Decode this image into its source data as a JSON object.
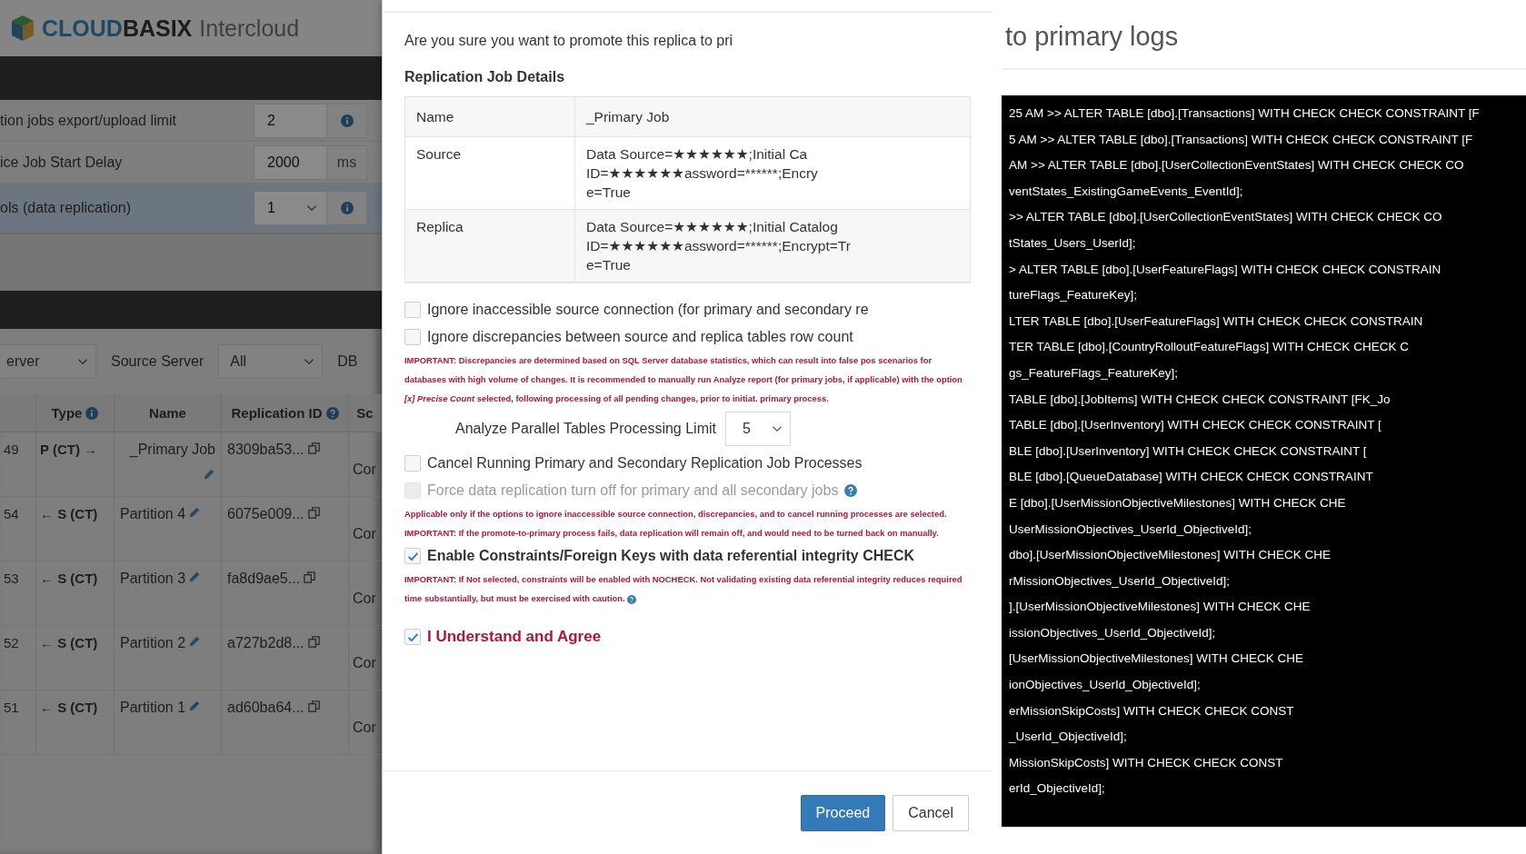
{
  "background_app": {
    "brand": {
      "first": "CLOUD",
      "second": "BASIX",
      "product": "Intercloud"
    },
    "settings": [
      {
        "label": "tion jobs export/upload limit",
        "value": "2",
        "kind": "info",
        "selected": false
      },
      {
        "label": "ice Job Start Delay",
        "value": "2000",
        "kind": "unit",
        "unit": "ms",
        "selected": false
      },
      {
        "label": "ols (data replication)",
        "value": "1",
        "kind": "select-info",
        "selected": true
      }
    ],
    "filters": [
      {
        "kind": "select",
        "text": "erver"
      },
      {
        "kind": "label",
        "text": "Source Server"
      },
      {
        "kind": "select",
        "text": "All"
      },
      {
        "kind": "label",
        "text": "DB"
      }
    ],
    "table": {
      "columns": [
        "Type",
        "Name",
        "Replication ID",
        "Sc"
      ],
      "rows": [
        {
          "id": "49",
          "type": "P (CT) →",
          "name": "_Primary Job",
          "replication_id": "8309ba53...",
          "column_5": "Cor"
        },
        {
          "id": "54",
          "type": "← S (CT)",
          "name": "Partition 4",
          "replication_id": "6075e009...",
          "column_5": "Cor"
        },
        {
          "id": "53",
          "type": "← S (CT)",
          "name": "Partition 3",
          "replication_id": "fa8d9ae5...",
          "column_5": "Cor"
        },
        {
          "id": "52",
          "type": "← S (CT)",
          "name": "Partition 2",
          "replication_id": "a727b2d8...",
          "column_5": "Cor"
        },
        {
          "id": "51",
          "type": "← S (CT)",
          "name": "Partition 1",
          "replication_id": "ad60ba64...",
          "column_5": "Cor"
        }
      ]
    }
  },
  "modal": {
    "question": "Are you sure you want to promote this replica to pri",
    "details_title": "Replication Job Details",
    "details": [
      {
        "label": "Name",
        "value": "_Primary Job"
      },
      {
        "label": "Source",
        "value": "Data Source=★★★★★★;Initial Ca\nID=★★★★★★assword=******;Encry\ne=True"
      },
      {
        "label": "Replica",
        "value": "Data Source=★★★★★★;Initial Catalog\nID=★★★★★★assword=******;Encrypt=Tr\ne=True"
      }
    ],
    "options": [
      {
        "kind": "checkbox",
        "label": "Ignore inaccessible source connection (for primary and secondary re",
        "checked": false
      },
      {
        "kind": "checkbox",
        "label": "Ignore discrepancies between source and replica tables row count",
        "checked": false
      },
      {
        "kind": "note",
        "text": "IMPORTANT: Discrepancies are determined based on SQL Server database statistics, which can result into false pos scenarios for databases with high volume of changes. It is recommended to manually run Analyze report (for primary jobs, if applicable) with the option *[x] Precise Count* selected, following processing of all pending changes, prior to initiat. primary process."
      },
      {
        "kind": "select",
        "label": "Analyze Parallel Tables Processing Limit",
        "value": "5"
      },
      {
        "kind": "checkbox",
        "label": "Cancel Running Primary and Secondary Replication Job Processes",
        "checked": false
      },
      {
        "kind": "checkbox",
        "label": "Force data replication turn off for primary and all secondary jobs",
        "checked": false,
        "disabled": true,
        "help": true
      },
      {
        "kind": "note",
        "text": "Applicable only if the options to ignore inaccessible source connection, discrepancies, and to cancel running processes are selected."
      },
      {
        "kind": "note",
        "text": "IMPORTANT: If the promote-to-primary process fails, data replication will remain off, and would need to be turned back on manually."
      },
      {
        "kind": "emphasis",
        "label": "Enable Constraints/Foreign Keys with data referential integrity CHECK",
        "checked": true
      },
      {
        "kind": "note",
        "text": "IMPORTANT: If Not selected, constraints will be enabled with NOCHECK. Not validating existing data referential integrity reduces required time substantially, but must be exercised with caution.",
        "help": true
      },
      {
        "kind": "consent",
        "label": "I Understand and Agree",
        "checked": true
      }
    ],
    "buttons": [
      {
        "label": "Proceed",
        "kind": "primary"
      },
      {
        "label": "Cancel",
        "kind": "default"
      }
    ]
  },
  "log_panel": {
    "title": "to primary logs",
    "lines": [
      "25 AM >> ALTER TABLE [dbo].[Transactions] WITH CHECK CHECK CONSTRAINT [F",
      "5 AM >> ALTER TABLE [dbo].[Transactions] WITH CHECK CHECK CONSTRAINT [F",
      "AM >> ALTER TABLE [dbo].[UserCollectionEventStates] WITH CHECK CHECK CO",
      "ventStates_ExistingGameEvents_EventId];",
      ">> ALTER TABLE [dbo].[UserCollectionEventStates] WITH CHECK CHECK CO",
      "tStates_Users_UserId];",
      "> ALTER TABLE [dbo].[UserFeatureFlags] WITH CHECK CHECK CONSTRAIN",
      "tureFlags_FeatureKey];",
      "LTER TABLE [dbo].[UserFeatureFlags] WITH CHECK CHECK CONSTRAIN",
      "TER TABLE [dbo].[CountryRolloutFeatureFlags] WITH CHECK CHECK C",
      "gs_FeatureFlags_FeatureKey];",
      "TABLE [dbo].[JobItems] WITH CHECK CHECK CONSTRAINT [FK_Jo",
      "TABLE [dbo].[UserInventory] WITH CHECK CHECK CONSTRAINT [",
      "BLE [dbo].[UserInventory] WITH CHECK CHECK CONSTRAINT [",
      "BLE [dbo].[QueueDatabase] WITH CHECK CHECK CONSTRAINT",
      "E [dbo].[UserMissionObjectiveMilestones] WITH CHECK CHE",
      "UserMissionObjectives_UserId_ObjectiveId];",
      "dbo].[UserMissionObjectiveMilestones] WITH CHECK CHE",
      "rMissionObjectives_UserId_ObjectiveId];",
      "].[UserMissionObjectiveMilestones] WITH CHECK CHE",
      "issionObjectives_UserId_ObjectiveId];",
      "[UserMissionObjectiveMilestones] WITH CHECK CHE",
      "ionObjectives_UserId_ObjectiveId];",
      "erMissionSkipCosts] WITH CHECK CHECK CONST",
      "_UserId_ObjectiveId];",
      "MissionSkipCosts] WITH CHECK CHECK CONST",
      "erId_ObjectiveId];"
    ]
  }
}
